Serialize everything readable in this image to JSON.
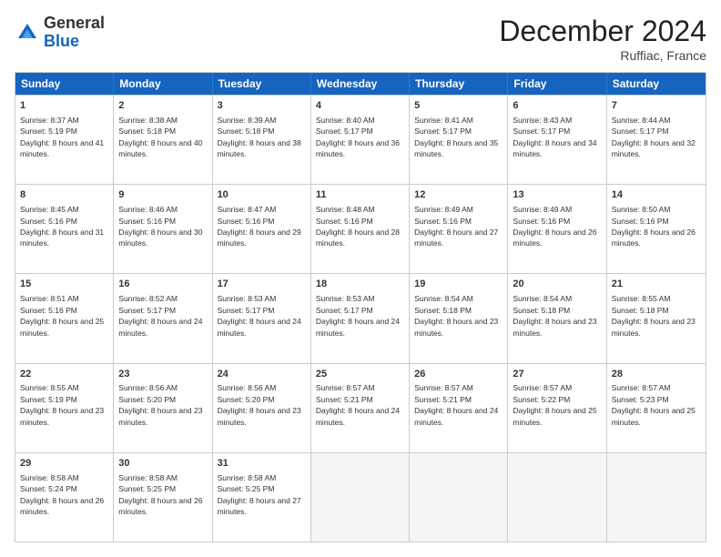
{
  "header": {
    "logo_general": "General",
    "logo_blue": "Blue",
    "month_title": "December 2024",
    "location": "Ruffiac, France"
  },
  "days_of_week": [
    "Sunday",
    "Monday",
    "Tuesday",
    "Wednesday",
    "Thursday",
    "Friday",
    "Saturday"
  ],
  "weeks": [
    [
      {
        "day": "1",
        "sunrise": "Sunrise: 8:37 AM",
        "sunset": "Sunset: 5:19 PM",
        "daylight": "Daylight: 8 hours and 41 minutes."
      },
      {
        "day": "2",
        "sunrise": "Sunrise: 8:38 AM",
        "sunset": "Sunset: 5:18 PM",
        "daylight": "Daylight: 8 hours and 40 minutes."
      },
      {
        "day": "3",
        "sunrise": "Sunrise: 8:39 AM",
        "sunset": "Sunset: 5:18 PM",
        "daylight": "Daylight: 8 hours and 38 minutes."
      },
      {
        "day": "4",
        "sunrise": "Sunrise: 8:40 AM",
        "sunset": "Sunset: 5:17 PM",
        "daylight": "Daylight: 8 hours and 36 minutes."
      },
      {
        "day": "5",
        "sunrise": "Sunrise: 8:41 AM",
        "sunset": "Sunset: 5:17 PM",
        "daylight": "Daylight: 8 hours and 35 minutes."
      },
      {
        "day": "6",
        "sunrise": "Sunrise: 8:43 AM",
        "sunset": "Sunset: 5:17 PM",
        "daylight": "Daylight: 8 hours and 34 minutes."
      },
      {
        "day": "7",
        "sunrise": "Sunrise: 8:44 AM",
        "sunset": "Sunset: 5:17 PM",
        "daylight": "Daylight: 8 hours and 32 minutes."
      }
    ],
    [
      {
        "day": "8",
        "sunrise": "Sunrise: 8:45 AM",
        "sunset": "Sunset: 5:16 PM",
        "daylight": "Daylight: 8 hours and 31 minutes."
      },
      {
        "day": "9",
        "sunrise": "Sunrise: 8:46 AM",
        "sunset": "Sunset: 5:16 PM",
        "daylight": "Daylight: 8 hours and 30 minutes."
      },
      {
        "day": "10",
        "sunrise": "Sunrise: 8:47 AM",
        "sunset": "Sunset: 5:16 PM",
        "daylight": "Daylight: 8 hours and 29 minutes."
      },
      {
        "day": "11",
        "sunrise": "Sunrise: 8:48 AM",
        "sunset": "Sunset: 5:16 PM",
        "daylight": "Daylight: 8 hours and 28 minutes."
      },
      {
        "day": "12",
        "sunrise": "Sunrise: 8:49 AM",
        "sunset": "Sunset: 5:16 PM",
        "daylight": "Daylight: 8 hours and 27 minutes."
      },
      {
        "day": "13",
        "sunrise": "Sunrise: 8:49 AM",
        "sunset": "Sunset: 5:16 PM",
        "daylight": "Daylight: 8 hours and 26 minutes."
      },
      {
        "day": "14",
        "sunrise": "Sunrise: 8:50 AM",
        "sunset": "Sunset: 5:16 PM",
        "daylight": "Daylight: 8 hours and 26 minutes."
      }
    ],
    [
      {
        "day": "15",
        "sunrise": "Sunrise: 8:51 AM",
        "sunset": "Sunset: 5:16 PM",
        "daylight": "Daylight: 8 hours and 25 minutes."
      },
      {
        "day": "16",
        "sunrise": "Sunrise: 8:52 AM",
        "sunset": "Sunset: 5:17 PM",
        "daylight": "Daylight: 8 hours and 24 minutes."
      },
      {
        "day": "17",
        "sunrise": "Sunrise: 8:53 AM",
        "sunset": "Sunset: 5:17 PM",
        "daylight": "Daylight: 8 hours and 24 minutes."
      },
      {
        "day": "18",
        "sunrise": "Sunrise: 8:53 AM",
        "sunset": "Sunset: 5:17 PM",
        "daylight": "Daylight: 8 hours and 24 minutes."
      },
      {
        "day": "19",
        "sunrise": "Sunrise: 8:54 AM",
        "sunset": "Sunset: 5:18 PM",
        "daylight": "Daylight: 8 hours and 23 minutes."
      },
      {
        "day": "20",
        "sunrise": "Sunrise: 8:54 AM",
        "sunset": "Sunset: 5:18 PM",
        "daylight": "Daylight: 8 hours and 23 minutes."
      },
      {
        "day": "21",
        "sunrise": "Sunrise: 8:55 AM",
        "sunset": "Sunset: 5:18 PM",
        "daylight": "Daylight: 8 hours and 23 minutes."
      }
    ],
    [
      {
        "day": "22",
        "sunrise": "Sunrise: 8:55 AM",
        "sunset": "Sunset: 5:19 PM",
        "daylight": "Daylight: 8 hours and 23 minutes."
      },
      {
        "day": "23",
        "sunrise": "Sunrise: 8:56 AM",
        "sunset": "Sunset: 5:20 PM",
        "daylight": "Daylight: 8 hours and 23 minutes."
      },
      {
        "day": "24",
        "sunrise": "Sunrise: 8:56 AM",
        "sunset": "Sunset: 5:20 PM",
        "daylight": "Daylight: 8 hours and 23 minutes."
      },
      {
        "day": "25",
        "sunrise": "Sunrise: 8:57 AM",
        "sunset": "Sunset: 5:21 PM",
        "daylight": "Daylight: 8 hours and 24 minutes."
      },
      {
        "day": "26",
        "sunrise": "Sunrise: 8:57 AM",
        "sunset": "Sunset: 5:21 PM",
        "daylight": "Daylight: 8 hours and 24 minutes."
      },
      {
        "day": "27",
        "sunrise": "Sunrise: 8:57 AM",
        "sunset": "Sunset: 5:22 PM",
        "daylight": "Daylight: 8 hours and 25 minutes."
      },
      {
        "day": "28",
        "sunrise": "Sunrise: 8:57 AM",
        "sunset": "Sunset: 5:23 PM",
        "daylight": "Daylight: 8 hours and 25 minutes."
      }
    ],
    [
      {
        "day": "29",
        "sunrise": "Sunrise: 8:58 AM",
        "sunset": "Sunset: 5:24 PM",
        "daylight": "Daylight: 8 hours and 26 minutes."
      },
      {
        "day": "30",
        "sunrise": "Sunrise: 8:58 AM",
        "sunset": "Sunset: 5:25 PM",
        "daylight": "Daylight: 8 hours and 26 minutes."
      },
      {
        "day": "31",
        "sunrise": "Sunrise: 8:58 AM",
        "sunset": "Sunset: 5:25 PM",
        "daylight": "Daylight: 8 hours and 27 minutes."
      },
      null,
      null,
      null,
      null
    ]
  ]
}
